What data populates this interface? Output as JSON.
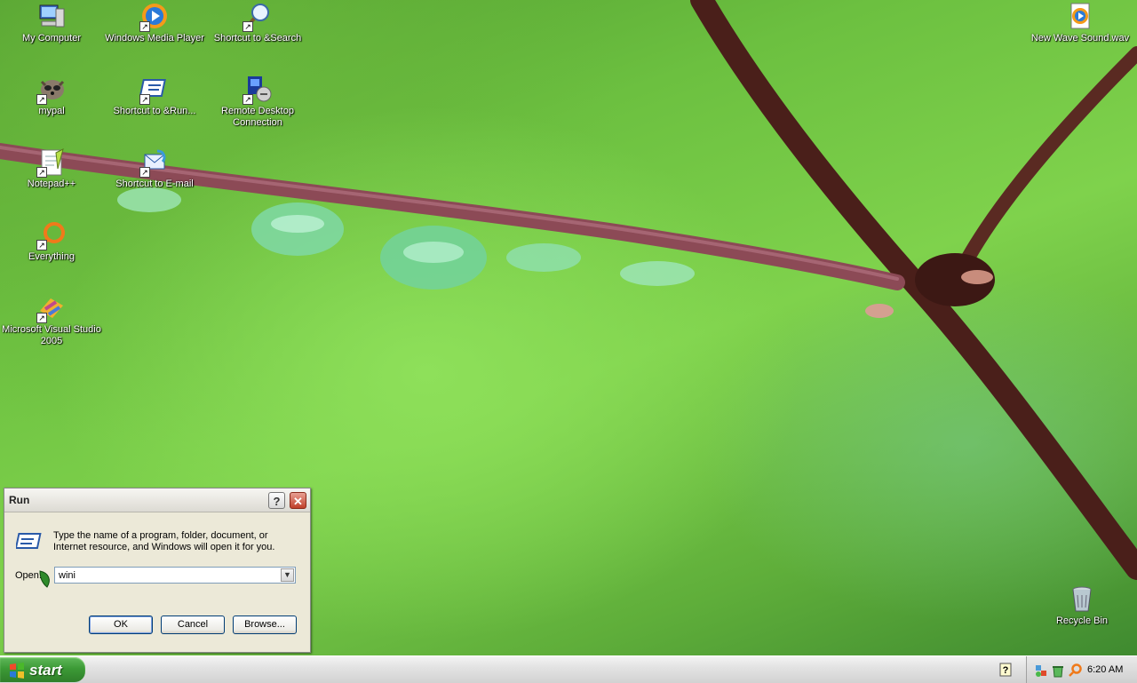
{
  "desktop": {
    "icons": [
      {
        "name": "my-computer",
        "label": "My Computer",
        "glyph": "computer-icon"
      },
      {
        "name": "windows-media-player",
        "label": "Windows Media Player",
        "glyph": "media-player-icon"
      },
      {
        "name": "shortcut-search",
        "label": "Shortcut to &Search",
        "glyph": "search-icon"
      },
      {
        "name": "mypal",
        "label": "mypal",
        "glyph": "raccoon-icon"
      },
      {
        "name": "shortcut-run",
        "label": "Shortcut to &Run...",
        "glyph": "run-icon"
      },
      {
        "name": "remote-desktop",
        "label": "Remote Desktop Connection",
        "glyph": "remote-desktop-icon"
      },
      {
        "name": "notepad-plus",
        "label": "Notepad++",
        "glyph": "notepad-icon"
      },
      {
        "name": "shortcut-email",
        "label": "Shortcut to E-mail",
        "glyph": "email-icon"
      },
      {
        "name": "everything",
        "label": "Everything",
        "glyph": "magnifier-ring-icon"
      },
      {
        "name": "visual-studio",
        "label": "Microsoft Visual Studio 2005",
        "glyph": "visual-studio-icon"
      },
      {
        "name": "new-wave-sound",
        "label": "New Wave Sound.wav",
        "glyph": "wav-file-icon"
      },
      {
        "name": "recycle-bin",
        "label": "Recycle Bin",
        "glyph": "recycle-bin-icon"
      }
    ]
  },
  "run_dialog": {
    "title": "Run",
    "help_glyph": "?",
    "close_glyph": "✕",
    "description": "Type the name of a program, folder, document, or Internet resource, and Windows will open it for you.",
    "open_label": "Open:",
    "open_value": "wini",
    "ok_label": "OK",
    "cancel_label": "Cancel",
    "browse_label": "Browse..."
  },
  "taskbar": {
    "start_label": "start",
    "clock": "6:20 AM",
    "help_glyph": "?"
  }
}
